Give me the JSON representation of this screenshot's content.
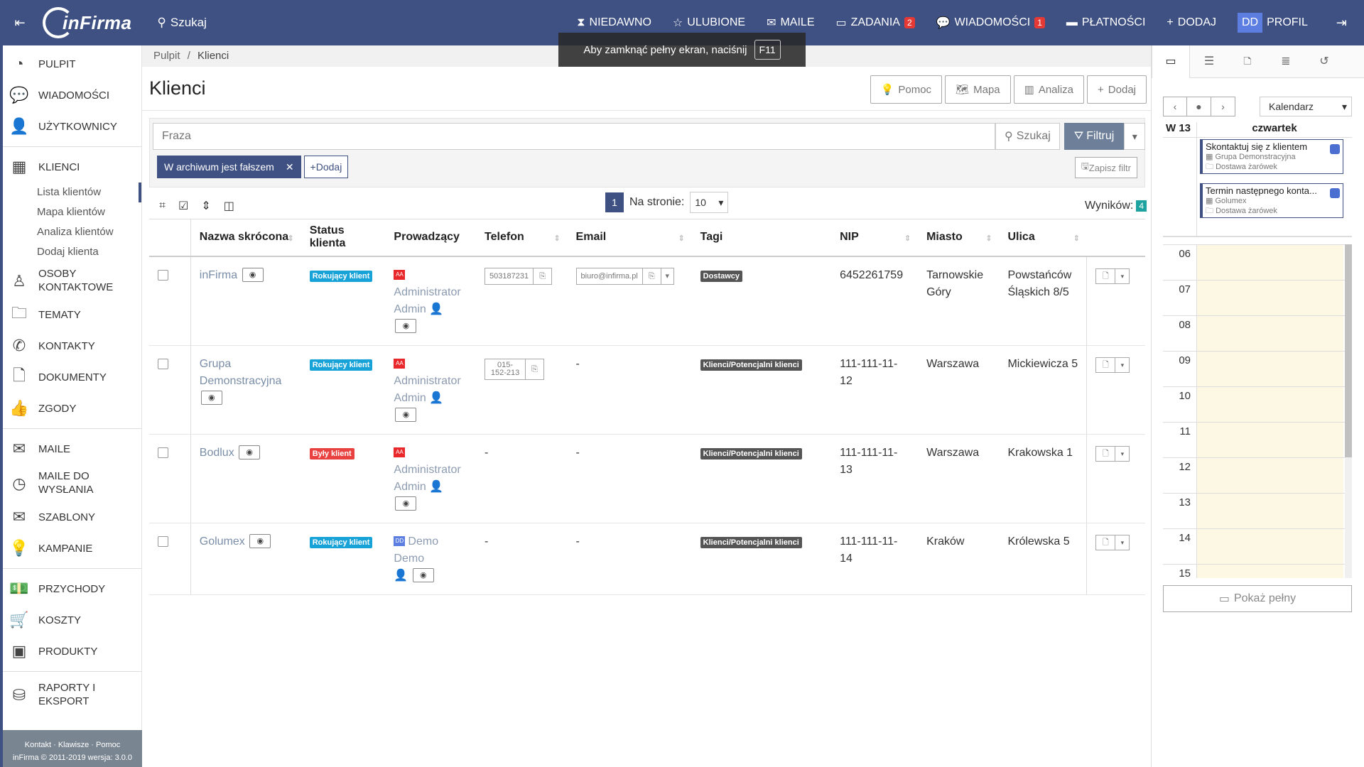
{
  "topbar": {
    "search_label": "Szukaj",
    "nav": [
      {
        "label": "NIEDAWNO",
        "icon": "hourglass-icon"
      },
      {
        "label": "ULUBIONE",
        "icon": "star-icon"
      },
      {
        "label": "MAILE",
        "icon": "envelope-icon"
      },
      {
        "label": "ZADANIA",
        "icon": "calendar-icon",
        "badge": "2"
      },
      {
        "label": "WIADOMOŚCI",
        "icon": "chat-icon",
        "badge": "1"
      },
      {
        "label": "PŁATNOŚCI",
        "icon": "card-icon"
      },
      {
        "label": "DODAJ",
        "icon": "plus-icon"
      }
    ],
    "profile_initials": "DD",
    "profile_label": "PROFIL"
  },
  "toast": {
    "text": "Aby zamknąć pełny ekran, naciśnij",
    "key": "F11"
  },
  "sidebar": {
    "items": [
      {
        "label": "PULPIT",
        "icon": "dashboard-icon"
      },
      {
        "label": "WIADOMOŚCI",
        "icon": "chat-icon"
      },
      {
        "label": "UŻYTKOWNICY",
        "icon": "user-icon"
      },
      {
        "label": "KLIENCI",
        "icon": "building-icon"
      },
      {
        "label": "OSOBY KONTAKTOWE",
        "icon": "person-icon"
      },
      {
        "label": "TEMATY",
        "icon": "folder-icon"
      },
      {
        "label": "KONTAKTY",
        "icon": "phone-icon"
      },
      {
        "label": "DOKUMENTY",
        "icon": "document-icon"
      },
      {
        "label": "ZGODY",
        "icon": "thumbs-up-icon"
      },
      {
        "label": "MAILE",
        "icon": "envelope-icon"
      },
      {
        "label": "MAILE DO WYSŁANIA",
        "icon": "clock-icon"
      },
      {
        "label": "SZABLONY",
        "icon": "template-icon"
      },
      {
        "label": "KAMPANIE",
        "icon": "bulb-icon"
      },
      {
        "label": "PRZYCHODY",
        "icon": "money-icon"
      },
      {
        "label": "KOSZTY",
        "icon": "cart-icon"
      },
      {
        "label": "PRODUKTY",
        "icon": "box-icon"
      },
      {
        "label": "RAPORTY I EKSPORT",
        "icon": "database-icon"
      }
    ],
    "sub_items": [
      "Lista klientów",
      "Mapa klientów",
      "Analiza klientów",
      "Dodaj klienta"
    ],
    "footer_links": "Kontakt · Klawisze · Pomoc",
    "footer_copy": "inFirma © 2011-2019 wersja: 3.0.0"
  },
  "breadcrumb": {
    "root": "Pulpit",
    "separator": "/",
    "current": "Klienci"
  },
  "page": {
    "title": "Klienci",
    "buttons": [
      "Pomoc",
      "Mapa",
      "Analiza",
      "Dodaj"
    ]
  },
  "filter": {
    "placeholder": "Fraza",
    "search_label": "Szukaj",
    "filter_label": "Filtruj",
    "chip_label": "W archiwum jest fałszem",
    "add_label": "Dodaj",
    "save_label": "Zapisz filtr"
  },
  "pager": {
    "page": "1",
    "per_page_label": "Na stronie:",
    "per_page": "10",
    "results_label": "Wyników:",
    "results_count": "4"
  },
  "table": {
    "headers": [
      "Nazwa skrócona",
      "Status klienta",
      "Prowadzący",
      "Telefon",
      "Email",
      "Tagi",
      "NIP",
      "Miasto",
      "Ulica"
    ],
    "rows": [
      {
        "name": "inFirma",
        "status": "Rokujący klient",
        "status_type": "active",
        "owner_initials": "AA",
        "owner": "Administrator Admin",
        "phone": "503187231",
        "email": "biuro@infirma.pl",
        "tag": "Dostawcy",
        "nip": "6452261759",
        "city": "Tarnowskie Góry",
        "street": "Powstańców Śląskich 8/5"
      },
      {
        "name": "Grupa Demonstracyjna",
        "status": "Rokujący klient",
        "status_type": "active",
        "owner_initials": "AA",
        "owner": "Administrator Admin",
        "phone": "015-152-213",
        "email": "-",
        "tag": "Klienci/Potencjalni klienci",
        "nip": "111-111-11-12",
        "city": "Warszawa",
        "street": "Mickiewicza 5"
      },
      {
        "name": "Bodlux",
        "status": "Były klient",
        "status_type": "former",
        "owner_initials": "AA",
        "owner": "Administrator Admin",
        "phone": "-",
        "email": "-",
        "tag": "Klienci/Potencjalni klienci",
        "nip": "111-111-11-13",
        "city": "Warszawa",
        "street": "Krakowska 1"
      },
      {
        "name": "Golumex",
        "status": "Rokujący klient",
        "status_type": "active",
        "owner_initials": "DD",
        "owner": "Demo Demo",
        "phone": "-",
        "email": "-",
        "tag": "Klienci/Potencjalni klienci",
        "nip": "111-111-11-14",
        "city": "Kraków",
        "street": "Królewska 5"
      }
    ]
  },
  "calendar": {
    "view_label": "Kalendarz",
    "week": "W 13",
    "day": "czwartek",
    "events": [
      {
        "title": "Skontaktuj się z klientem",
        "client": "Grupa Demonstracyjna",
        "topic": "Dostawa żarówek"
      },
      {
        "title": "Termin następnego konta...",
        "client": "Golumex",
        "topic": "Dostawa żarówek"
      }
    ],
    "hours": [
      "06",
      "07",
      "08",
      "09",
      "10",
      "11",
      "12",
      "13",
      "14",
      "15"
    ],
    "full_label": "Pokaż pełny"
  }
}
